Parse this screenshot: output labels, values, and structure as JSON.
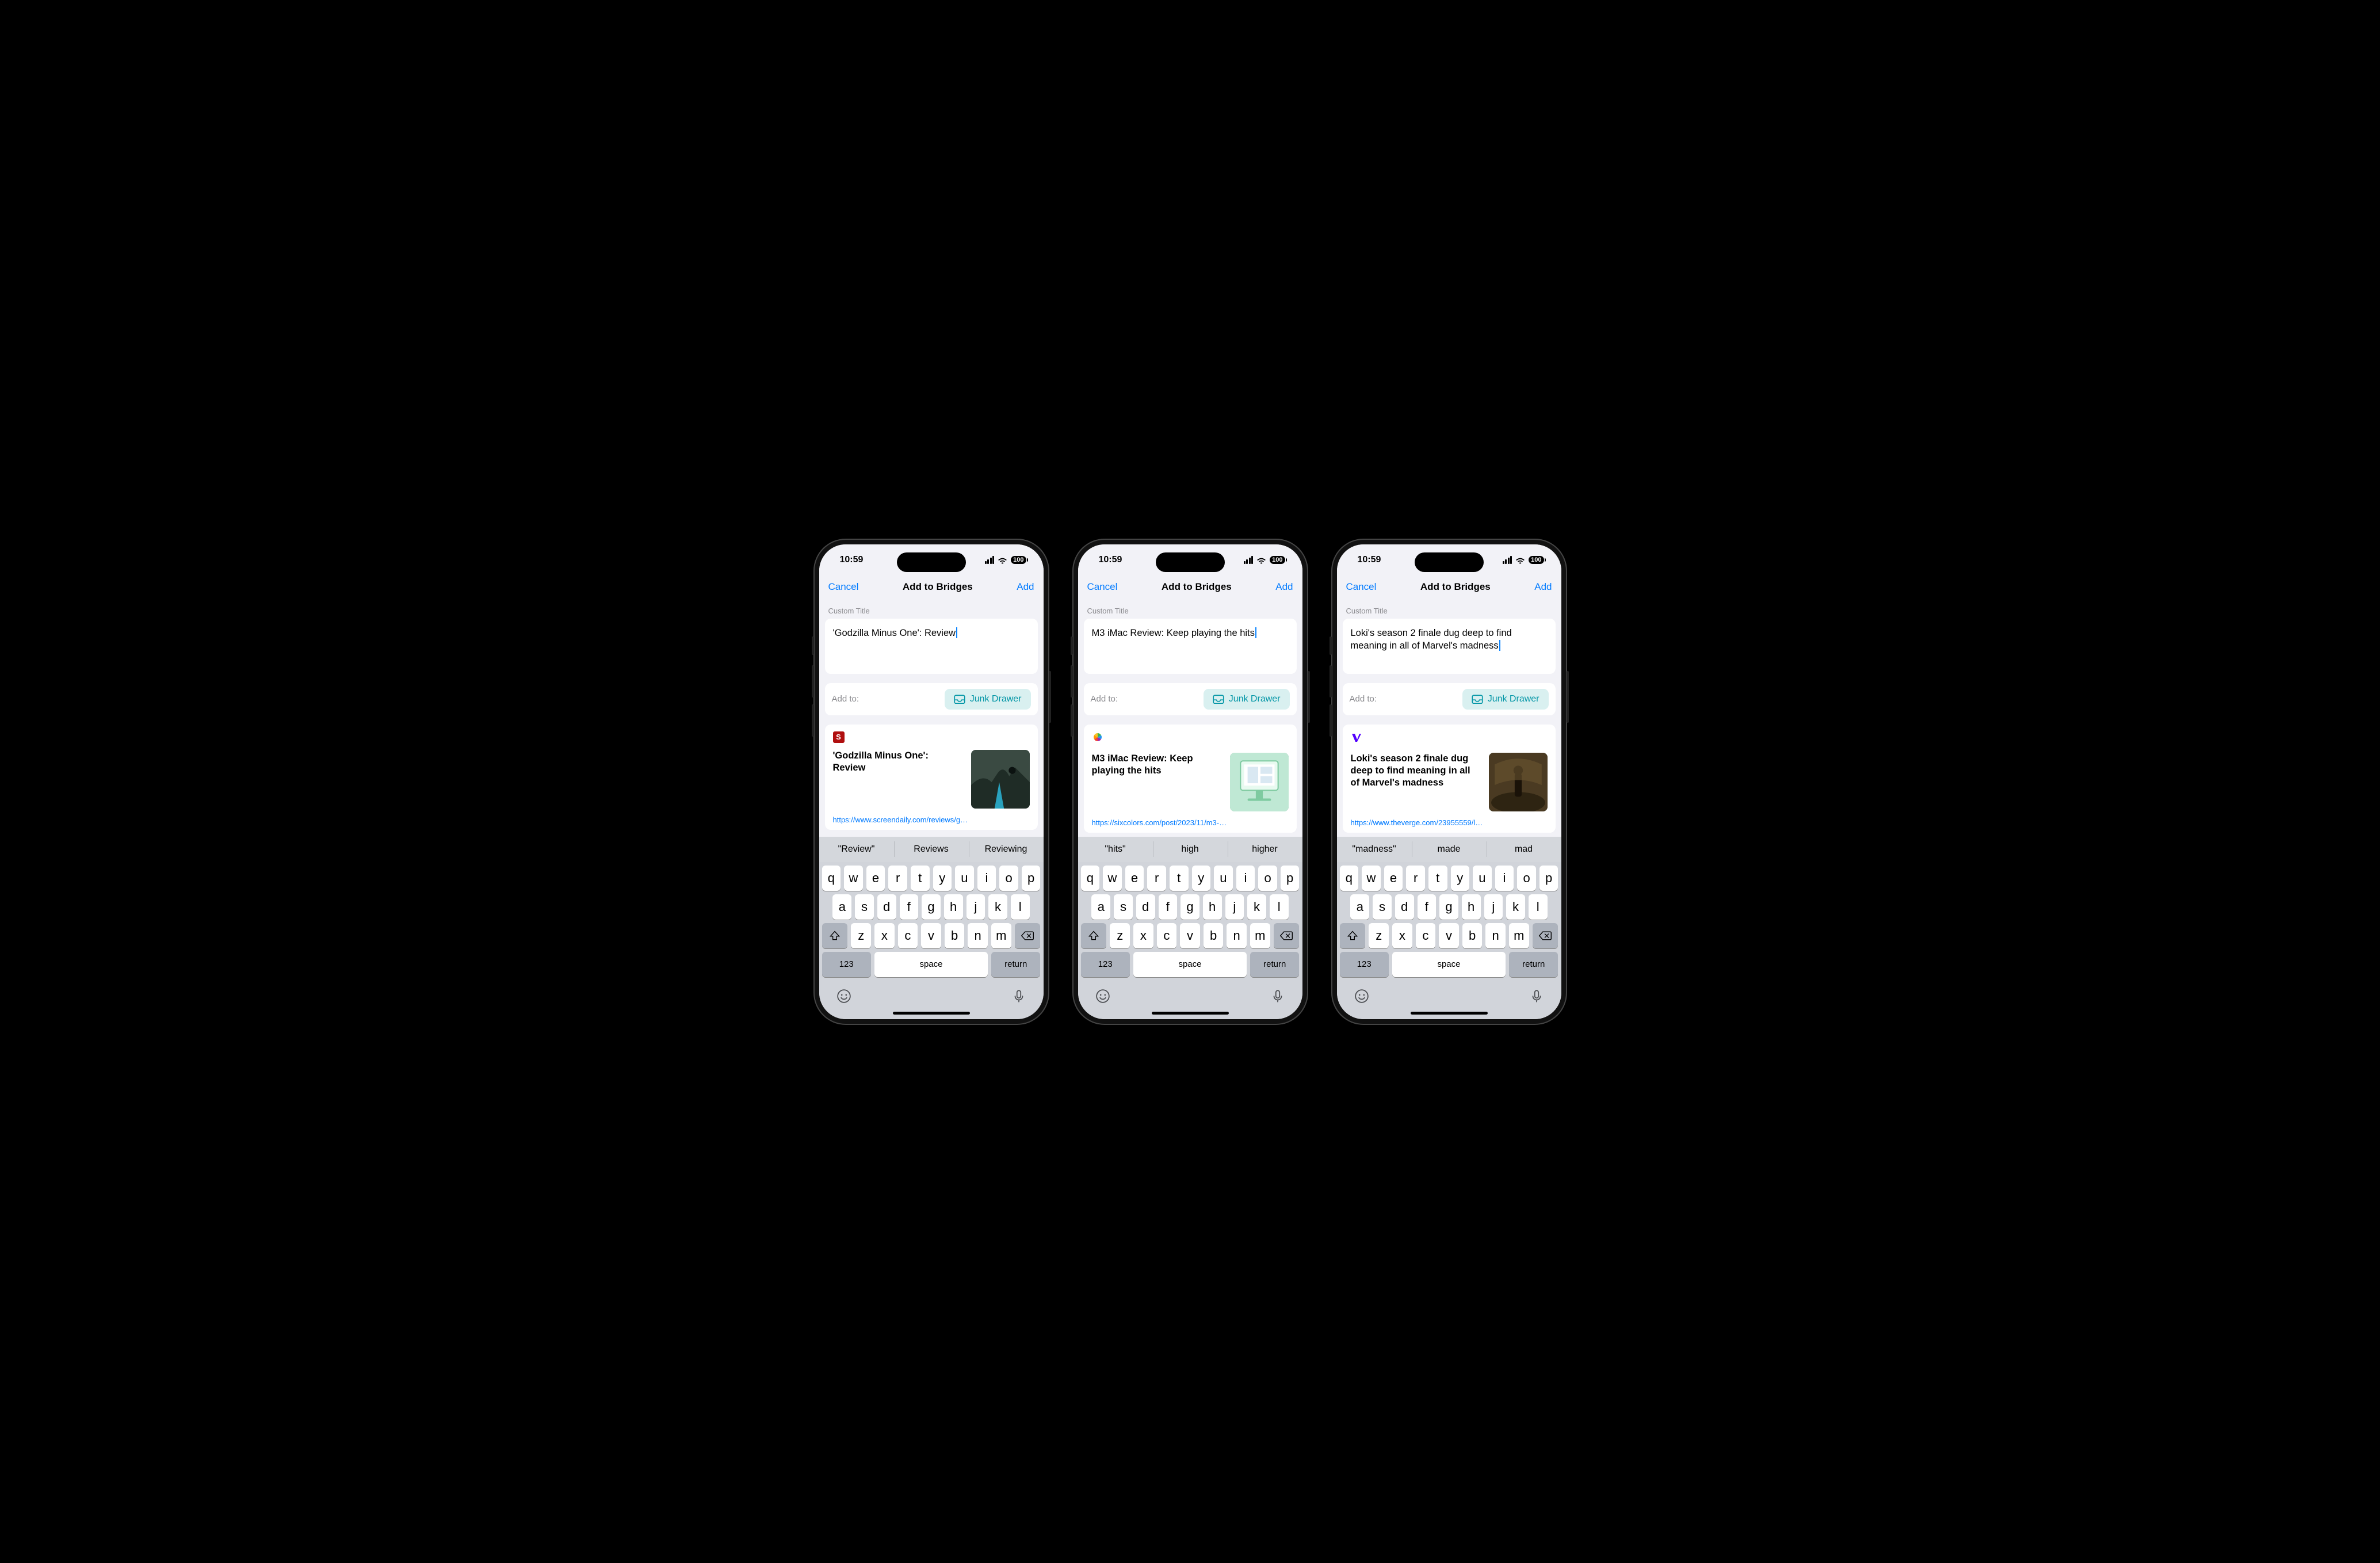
{
  "status": {
    "time": "10:59",
    "battery": "100"
  },
  "nav": {
    "cancel": "Cancel",
    "title": "Add to Bridges",
    "add": "Add"
  },
  "labels": {
    "custom_title": "Custom Title",
    "add_to": "Add to:"
  },
  "destination": {
    "name": "Junk Drawer"
  },
  "keyboard": {
    "rows": {
      "r1": [
        "q",
        "w",
        "e",
        "r",
        "t",
        "y",
        "u",
        "i",
        "o",
        "p"
      ],
      "r2": [
        "a",
        "s",
        "d",
        "f",
        "g",
        "h",
        "j",
        "k",
        "l"
      ],
      "r3": [
        "z",
        "x",
        "c",
        "v",
        "b",
        "n",
        "m"
      ]
    },
    "num": "123",
    "space": "space",
    "ret": "return"
  },
  "phones": [
    {
      "title_input": "'Godzilla Minus One': Review",
      "favicon_bg": "#b00f0f",
      "favicon_letter": "S",
      "preview_title": "'Godzilla Minus One': Review",
      "url": "https://www.screendaily.com/reviews/g…",
      "suggestions": [
        "\"Review\"",
        "Reviews",
        "Reviewing"
      ],
      "thumb": "godzilla"
    },
    {
      "title_input": "M3 iMac Review: Keep playing the hits",
      "favicon_bg": "transparent",
      "favicon_letter": "sixcolors",
      "preview_title": "M3 iMac Review: Keep playing the hits",
      "url": "https://sixcolors.com/post/2023/11/m3-…",
      "suggestions": [
        "\"hits\"",
        "high",
        "higher"
      ],
      "thumb": "imac"
    },
    {
      "title_input": "Loki's season 2 finale dug deep to find meaning in all of Marvel's madness",
      "favicon_bg": "transparent",
      "favicon_letter": "verge",
      "preview_title": "Loki's season 2 finale dug deep to find meaning in all of Marvel's madness",
      "url": "https://www.theverge.com/23955559/l…",
      "suggestions": [
        "\"madness\"",
        "made",
        "mad"
      ],
      "thumb": "loki"
    }
  ]
}
